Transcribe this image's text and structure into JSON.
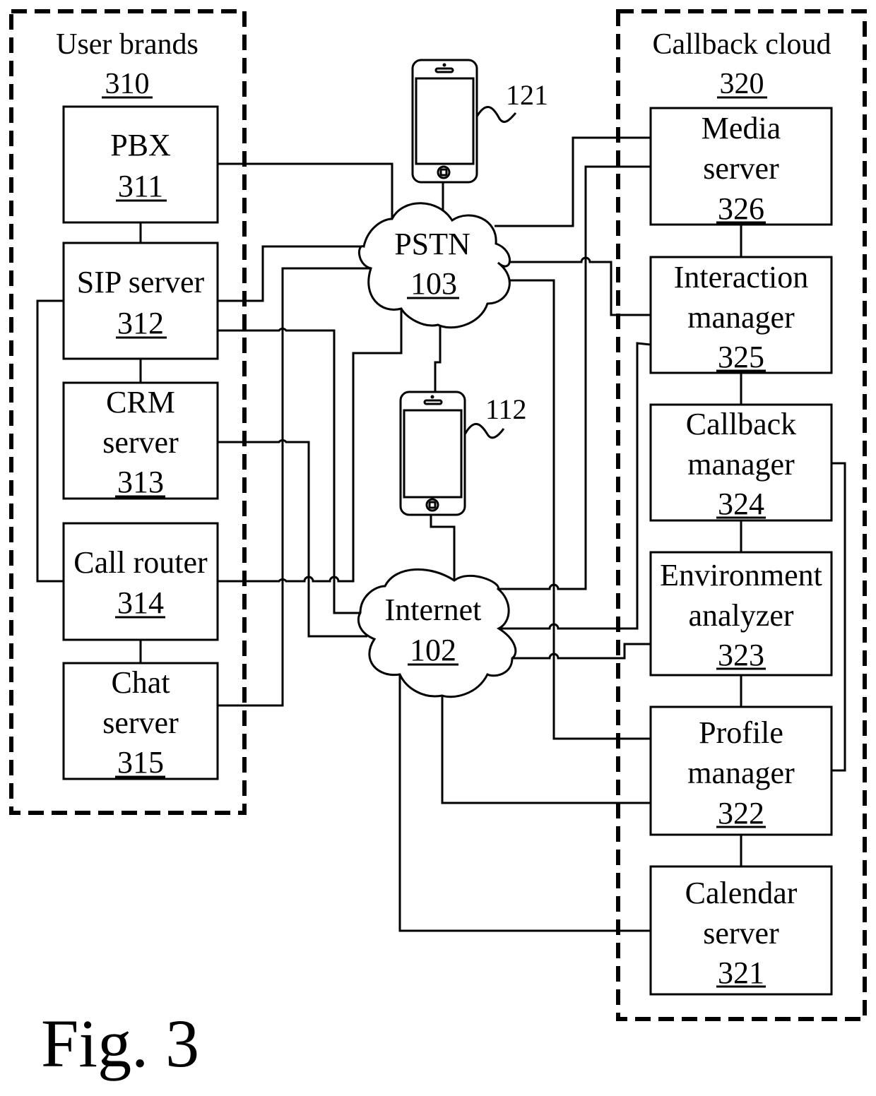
{
  "figure_label": "Fig. 3",
  "groups": {
    "user_brands": {
      "title": "User brands",
      "ref": "310"
    },
    "callback_cloud": {
      "title": "Callback cloud",
      "ref": "320"
    }
  },
  "user_components": [
    {
      "id": "pbx",
      "lines": [
        "PBX"
      ],
      "ref": "311"
    },
    {
      "id": "sip-server",
      "lines": [
        "SIP server"
      ],
      "ref": "312"
    },
    {
      "id": "crm-server",
      "lines": [
        "CRM",
        "server"
      ],
      "ref": "313"
    },
    {
      "id": "call-router",
      "lines": [
        "Call router"
      ],
      "ref": "314"
    },
    {
      "id": "chat-server",
      "lines": [
        "Chat",
        "server"
      ],
      "ref": "315"
    }
  ],
  "cloud_components": [
    {
      "id": "media-server",
      "lines": [
        "Media",
        "server"
      ],
      "ref": "326"
    },
    {
      "id": "interaction-manager",
      "lines": [
        "Interaction",
        "manager"
      ],
      "ref": "325"
    },
    {
      "id": "callback-manager",
      "lines": [
        "Callback",
        "manager"
      ],
      "ref": "324"
    },
    {
      "id": "environment-analyzer",
      "lines": [
        "Environment",
        "analyzer"
      ],
      "ref": "323"
    },
    {
      "id": "profile-manager",
      "lines": [
        "Profile",
        "manager"
      ],
      "ref": "322"
    },
    {
      "id": "calendar-server",
      "lines": [
        "Calendar",
        "server"
      ],
      "ref": "321"
    }
  ],
  "networks": {
    "pstn": {
      "label": "PSTN",
      "ref": "103"
    },
    "internet": {
      "label": "Internet",
      "ref": "102"
    }
  },
  "devices": {
    "phone_top": {
      "ref": "121",
      "icon": "smartphone-icon"
    },
    "phone_mid": {
      "ref": "112",
      "icon": "smartphone-icon"
    }
  }
}
